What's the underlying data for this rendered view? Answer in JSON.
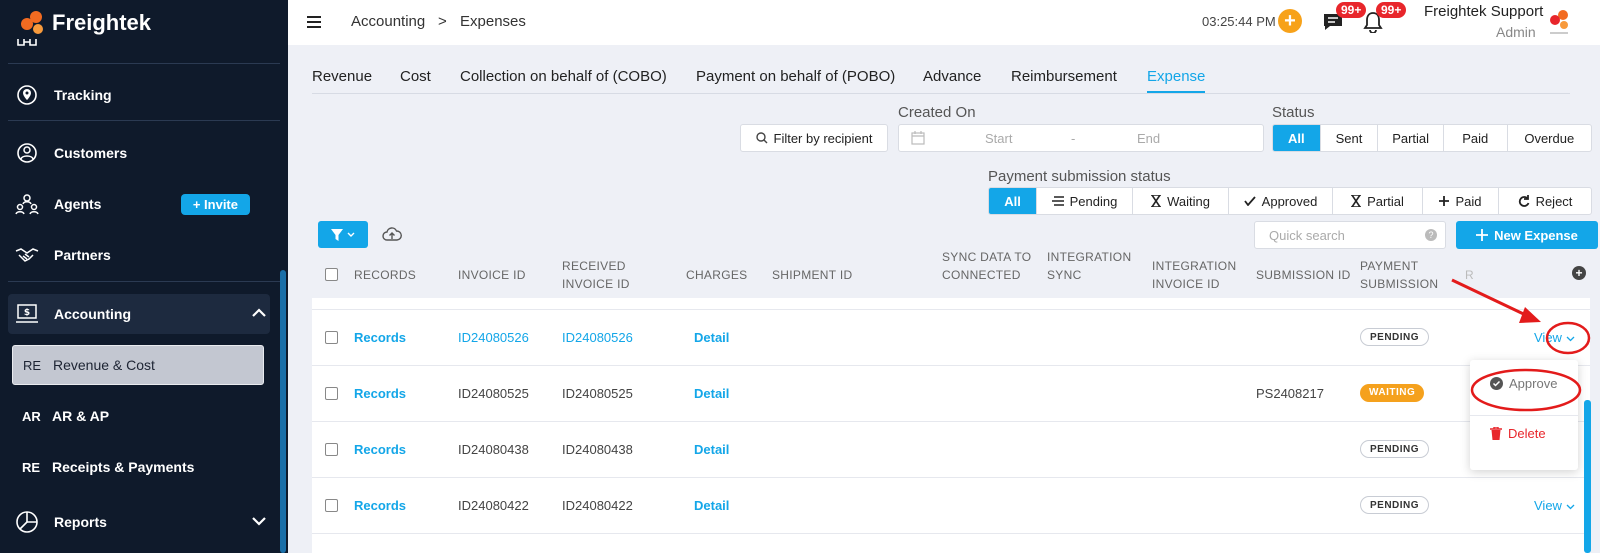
{
  "app": {
    "name": "Freightek"
  },
  "sidebar": {
    "items": [
      {
        "label": "Tracking"
      },
      {
        "label": "Customers"
      },
      {
        "label": "Agents"
      },
      {
        "label": "Partners"
      },
      {
        "label": "Accounting"
      },
      {
        "label": "Reports"
      }
    ],
    "invite_label": "Invite",
    "subitems": [
      {
        "abbr": "RE",
        "label": "Revenue & Cost"
      },
      {
        "abbr": "AR",
        "label": "AR & AP"
      },
      {
        "abbr": "RE",
        "label": "Receipts & Payments"
      }
    ]
  },
  "header": {
    "breadcrumb": [
      "Accounting",
      ">",
      "Expenses"
    ],
    "time": "03:25:44 PM",
    "messages_badge": "99+",
    "notifications_badge": "99+",
    "user_name": "Freightek Support",
    "user_role": "Admin"
  },
  "tabs": [
    "Revenue",
    "Cost",
    "Collection on behalf of (COBO)",
    "Payment on behalf of (POBO)",
    "Advance",
    "Reimbursement",
    "Expense"
  ],
  "filters": {
    "recipient_label": "Filter by recipient",
    "created_on_label": "Created On",
    "date_start": "Start",
    "date_sep": "-",
    "date_end": "End",
    "status_label": "Status",
    "status_options": [
      "All",
      "Sent",
      "Partial",
      "Paid",
      "Overdue"
    ],
    "payment_status_label": "Payment submission status",
    "payment_status_options": [
      "All",
      "Pending",
      "Waiting",
      "Approved",
      "Partial",
      "Paid",
      "Reject"
    ]
  },
  "toolbar": {
    "quick_search_placeholder": "Quick search",
    "new_expense_label": "New Expense"
  },
  "table": {
    "headers": [
      "RECORDS",
      "INVOICE ID",
      "RECEIVED INVOICE ID",
      "CHARGES",
      "SHIPMENT ID",
      "SYNC DATA TO CONNECTED APPS",
      "INTEGRATION SYNC CREATEDBY",
      "INTEGRATION INVOICE ID",
      "SUBMISSION ID",
      "PAYMENT SUBMISSION",
      "R"
    ],
    "rows": [
      {
        "records": "Records",
        "invoice_id": "ID24080526",
        "received_invoice_id": "ID24080526",
        "charges": "Detail",
        "submission_id": "",
        "payment_submission": "PENDING",
        "action": "View"
      },
      {
        "records": "Records",
        "invoice_id": "ID24080525",
        "received_invoice_id": "ID24080525",
        "charges": "Detail",
        "submission_id": "PS2408217",
        "payment_submission": "WAITING",
        "action": ""
      },
      {
        "records": "Records",
        "invoice_id": "ID24080438",
        "received_invoice_id": "ID24080438",
        "charges": "Detail",
        "submission_id": "",
        "payment_submission": "PENDING",
        "action": ""
      },
      {
        "records": "Records",
        "invoice_id": "ID24080422",
        "received_invoice_id": "ID24080422",
        "charges": "Detail",
        "submission_id": "",
        "payment_submission": "PENDING",
        "action": "View"
      }
    ]
  },
  "dropdown": {
    "approve_label": "Approve",
    "delete_label": "Delete"
  },
  "colors": {
    "accent": "#13a6e8",
    "sidebar": "#0f1a2b",
    "warning": "#f5a11d",
    "danger": "#e8262b",
    "annotation": "#e31b1b"
  }
}
